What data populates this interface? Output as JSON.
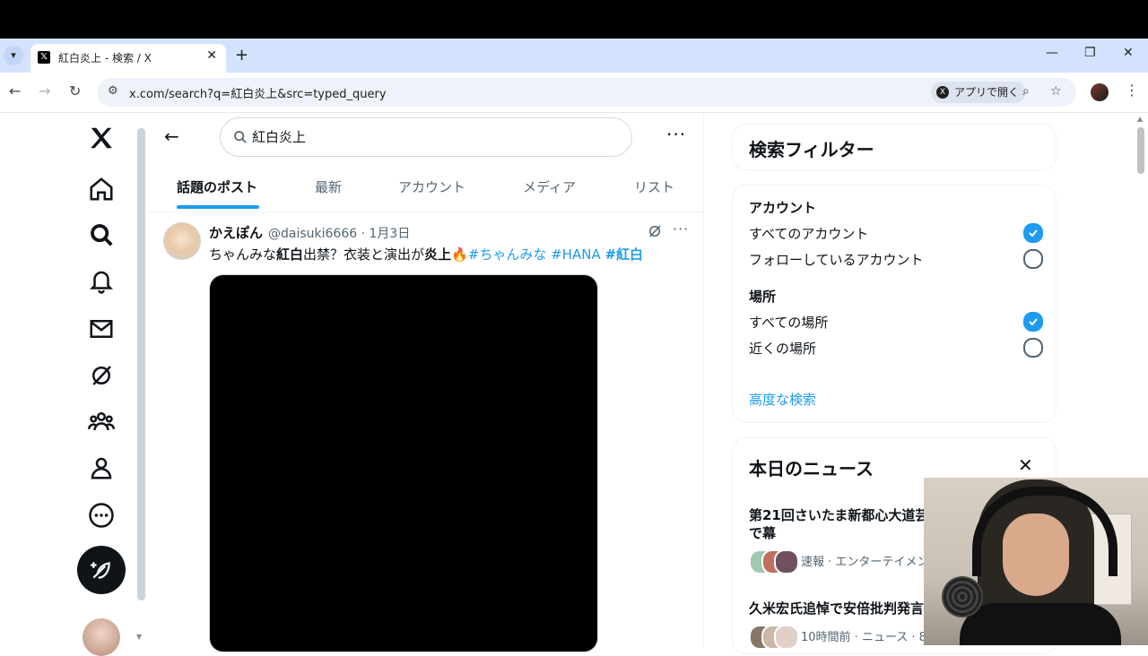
{
  "browser": {
    "tab_title": "紅白炎上 - 検索 / X",
    "url": "x.com/search?q=紅白炎上&src=typed_query",
    "open_in_app": "アプリで開く"
  },
  "search": {
    "query": "紅白炎上"
  },
  "tabs": [
    {
      "label": "話題のポスト",
      "active": true
    },
    {
      "label": "最新"
    },
    {
      "label": "アカウント"
    },
    {
      "label": "メディア"
    },
    {
      "label": "リスト"
    }
  ],
  "post": {
    "author": "かえぽん",
    "meta": "@daisuki6666 · 1月3日",
    "text_parts": {
      "p1": "ちゃんみな",
      "p2": "紅白",
      "p3": "出禁？衣装と演出が",
      "p4": "炎上",
      "p5": "🔥",
      "h1": "#ちゃんみな",
      "h2": "#HANA",
      "h3": "#紅白"
    }
  },
  "filters": {
    "title": "検索フィルター",
    "account_head": "アカウント",
    "account_options": [
      "すべてのアカウント",
      "フォローしているアカウント"
    ],
    "account_selected": 0,
    "location_head": "場所",
    "location_options": [
      "すべての場所",
      "近くの場所"
    ],
    "location_selected": 0,
    "advanced": "高度な検索"
  },
  "news": {
    "title": "本日のニュース",
    "items": [
      {
        "title": "第21回さいたま新都心大道芸 大盛況で幕",
        "meta": "速報 · エンターテイメン"
      },
      {
        "title": "久米宏氏追悼で安倍批判発言",
        "meta": "10時間前 · ニュース · 8."
      }
    ]
  },
  "colors": {
    "accent": "#1d9bf0",
    "text": "#0f1419",
    "muted": "#536471"
  }
}
